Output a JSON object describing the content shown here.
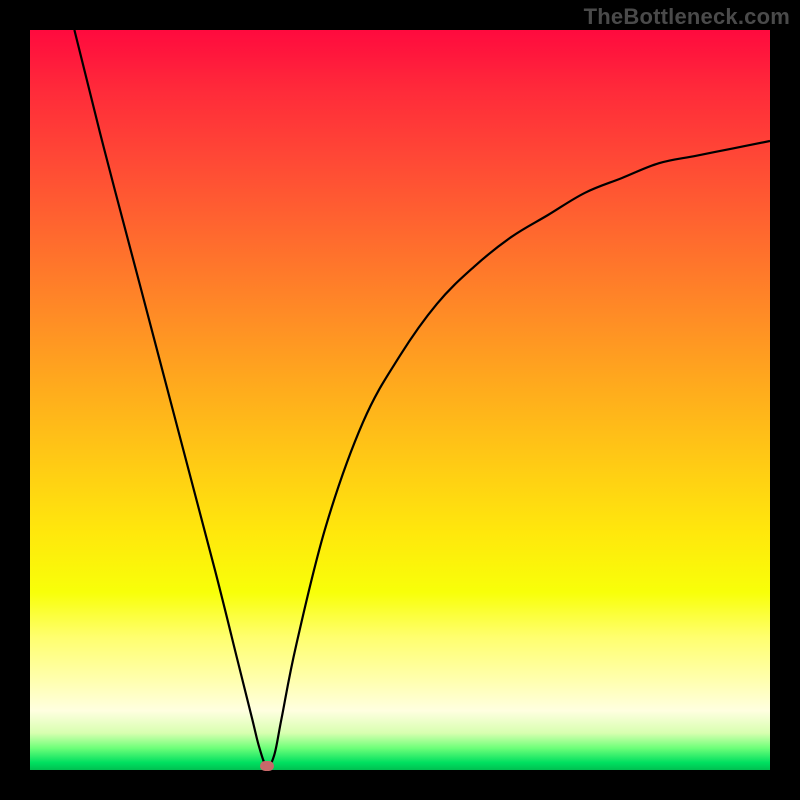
{
  "watermark": "TheBottleneck.com",
  "colors": {
    "curve_stroke": "#000000",
    "endpoint_dot": "#c9686a",
    "frame_bg": "#000000"
  },
  "chart_data": {
    "type": "line",
    "title": "",
    "xlabel": "",
    "ylabel": "",
    "xlim": [
      0,
      100
    ],
    "ylim": [
      0,
      100
    ],
    "grid": false,
    "legend": false,
    "series": [
      {
        "name": "bottleneck-curve",
        "x": [
          6,
          10,
          15,
          20,
          25,
          28,
          30,
          31,
          32,
          33,
          34,
          36,
          40,
          45,
          50,
          55,
          60,
          65,
          70,
          75,
          80,
          85,
          90,
          95,
          100
        ],
        "y": [
          100,
          84,
          65,
          46,
          27,
          15,
          7,
          3,
          0.5,
          2,
          7,
          17,
          33,
          47,
          56,
          63,
          68,
          72,
          75,
          78,
          80,
          82,
          83,
          84,
          85
        ]
      }
    ],
    "annotations": [
      {
        "type": "min-point",
        "x": 32,
        "y": 0.5
      }
    ]
  }
}
